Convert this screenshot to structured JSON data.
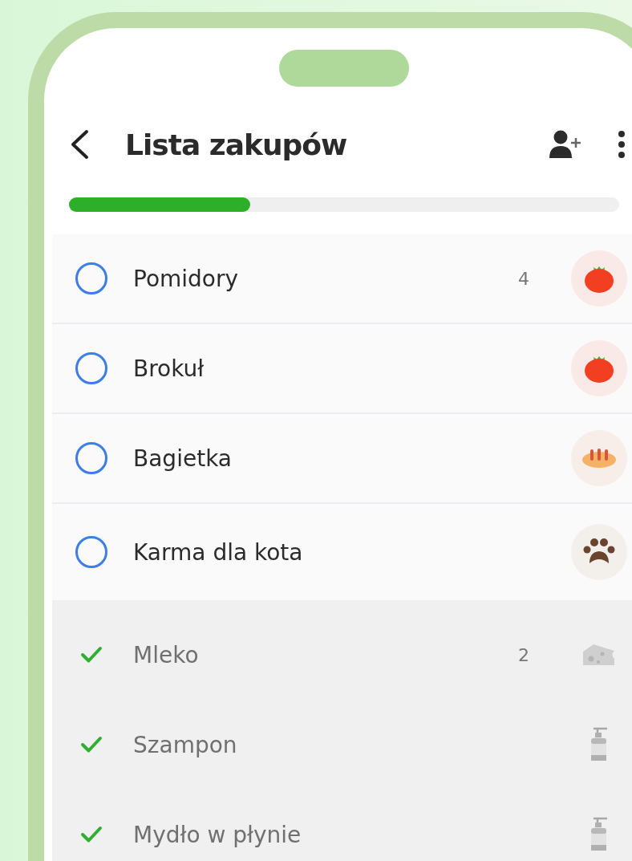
{
  "header": {
    "title": "Lista zakupów"
  },
  "progress": {
    "level": 0.33
  },
  "items": [
    {
      "name": "Pomidory",
      "quantity": "4",
      "checked": false,
      "kind": "tomato"
    },
    {
      "name": "Brokuł",
      "checked": false,
      "kind": "tomato"
    },
    {
      "name": "Bagietka",
      "checked": false,
      "kind": "bread"
    },
    {
      "name": "Karma dla kota",
      "checked": false,
      "kind": "paw"
    },
    {
      "name": "Mleko",
      "quantity": "2",
      "checked": true,
      "kind": "cheese"
    },
    {
      "name": "Szampon",
      "checked": true,
      "kind": "bottle"
    },
    {
      "name": "Mydło w płynie",
      "checked": true,
      "kind": "bottle"
    }
  ]
}
